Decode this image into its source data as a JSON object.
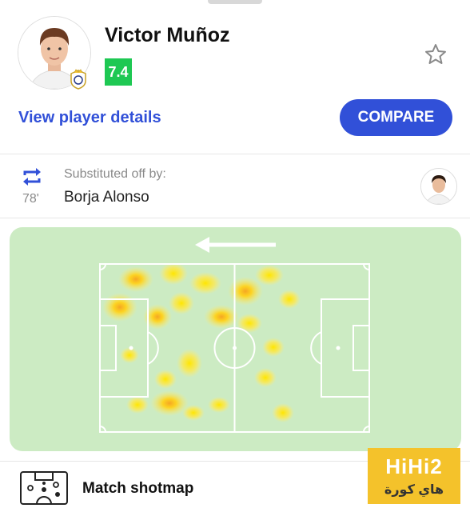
{
  "player": {
    "name": "Victor Muñoz",
    "rating": "7.4",
    "view_details_label": "View player details",
    "compare_label": "COMPARE"
  },
  "substitution": {
    "caption": "Substituted off by:",
    "player": "Borja Alonso",
    "minute": "78'"
  },
  "shotmap": {
    "label": "Match shotmap"
  },
  "watermark": {
    "line1": "HiHi2",
    "line2": "هاي كورة"
  },
  "colors": {
    "accent": "#3150d8",
    "rating_bg": "#1ec853",
    "heatmap_bg": "#ccebc3",
    "watermark_bg": "#f4c22b"
  },
  "icons": [
    "star-icon",
    "substitution-icon",
    "arrow-left-icon",
    "shotmap-icon",
    "club-crest-icon"
  ]
}
